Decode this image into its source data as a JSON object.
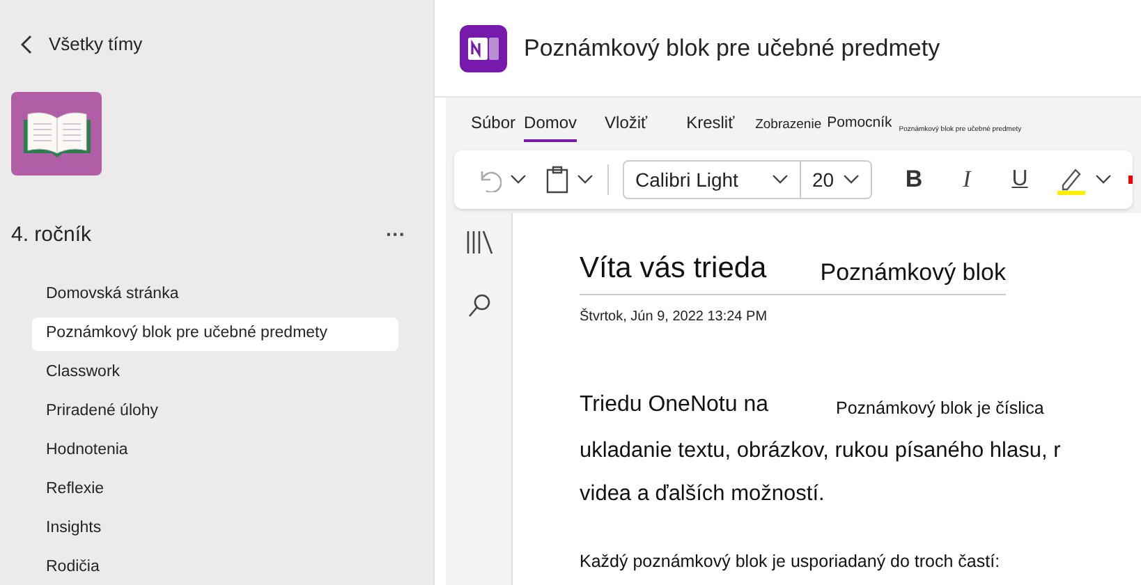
{
  "sidebar": {
    "back": "Všetky tímy",
    "team": "4. ročník",
    "more": "···",
    "items": [
      {
        "label": "Domovská stránka",
        "selected": false
      },
      {
        "label": "Poznámkový blok pre učebné predmety",
        "selected": true
      },
      {
        "label": "Classwork",
        "selected": false
      },
      {
        "label": "Priradené úlohy",
        "selected": false
      },
      {
        "label": "Hodnotenia",
        "selected": false
      },
      {
        "label": "Reflexie",
        "selected": false
      },
      {
        "label": "Insights",
        "selected": false
      },
      {
        "label": "Rodičia",
        "selected": false
      }
    ]
  },
  "header": {
    "title": "Poznámkový blok pre učebné predmety"
  },
  "ribbon_tabs": [
    {
      "label": "Súbor",
      "selected": false
    },
    {
      "label": "Domov",
      "selected": true
    },
    {
      "label": "Vložiť",
      "selected": false
    },
    {
      "label": "Kresliť",
      "selected": false
    },
    {
      "label": "Zobrazenie",
      "selected": false
    },
    {
      "label": "Pomocník",
      "selected": false
    },
    {
      "label": "Poznámkový blok pre učebné predmety",
      "selected": false
    }
  ],
  "toolbar": {
    "font": "Calibri Light",
    "size": "20",
    "bold": "B",
    "italic": "I",
    "underline": "U"
  },
  "page": {
    "title": "Víta vás trieda",
    "title_2": "Poznámkový blok",
    "date": "Štvrtok, Jún 9, 2022 13:24 PM",
    "line_1": "Triedu OneNotu na",
    "line_1b": "Poznámkový blok je číslica",
    "line_2": "ukladanie textu, obrázkov, rukou písaného hlasu,  r",
    "line_3": "videa a ďalších možností.",
    "line_4": "Každý poznámkový blok je usporiadaný do troch častí:"
  }
}
